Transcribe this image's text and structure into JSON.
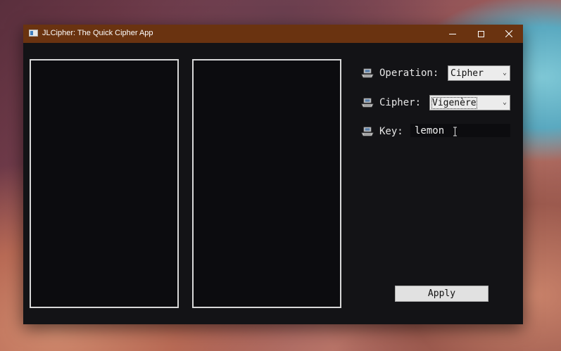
{
  "window": {
    "title": "JLCipher: The Quick Cipher App",
    "titlebar_color": "#6a3310",
    "background_color": "#131316"
  },
  "controls": {
    "operation": {
      "label": "Operation:",
      "selected": "Cipher"
    },
    "cipher": {
      "label": "Cipher:",
      "selected": "Vigenère"
    },
    "key": {
      "label": "Key:",
      "value": "lemon"
    },
    "apply_label": "Apply"
  },
  "icons": {
    "app": "app-window-icon",
    "row": "keyboard-icon"
  }
}
